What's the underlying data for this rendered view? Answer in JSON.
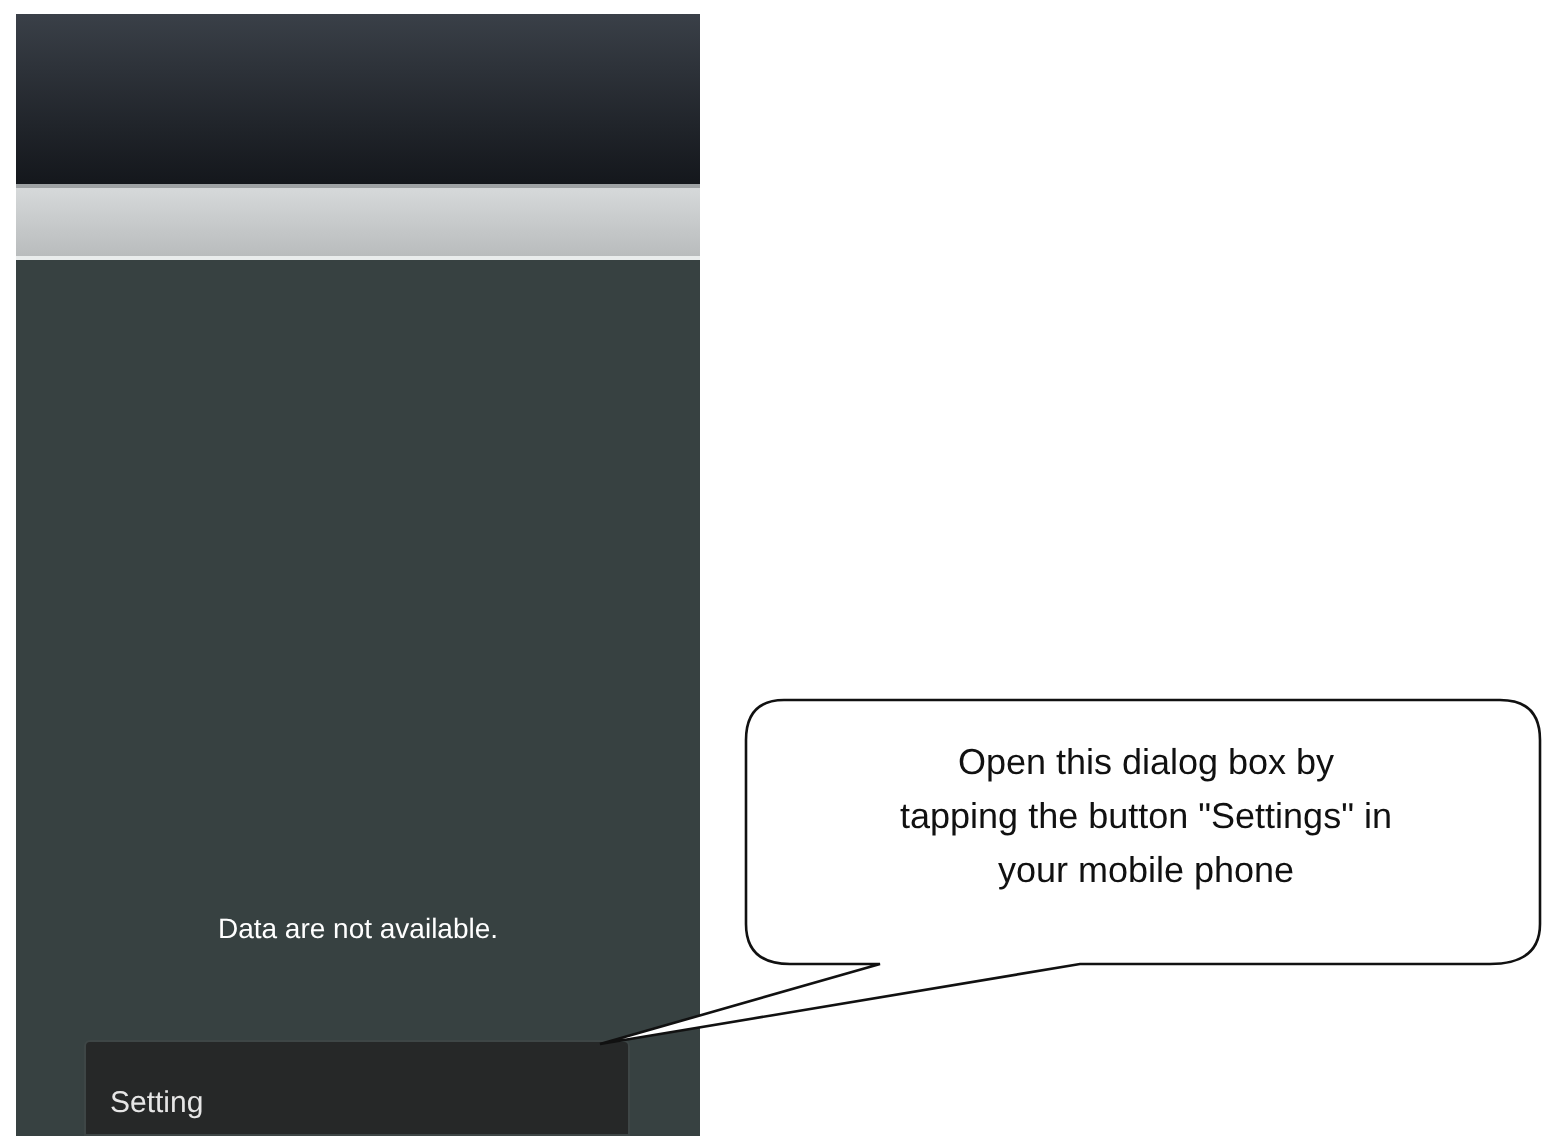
{
  "screen": {
    "message": "Data are not available.",
    "menu": {
      "items": [
        {
          "label": "Setting"
        }
      ]
    }
  },
  "callout": {
    "text": "Open this dialog box by tapping the button \"Settings\" in your mobile phone"
  }
}
